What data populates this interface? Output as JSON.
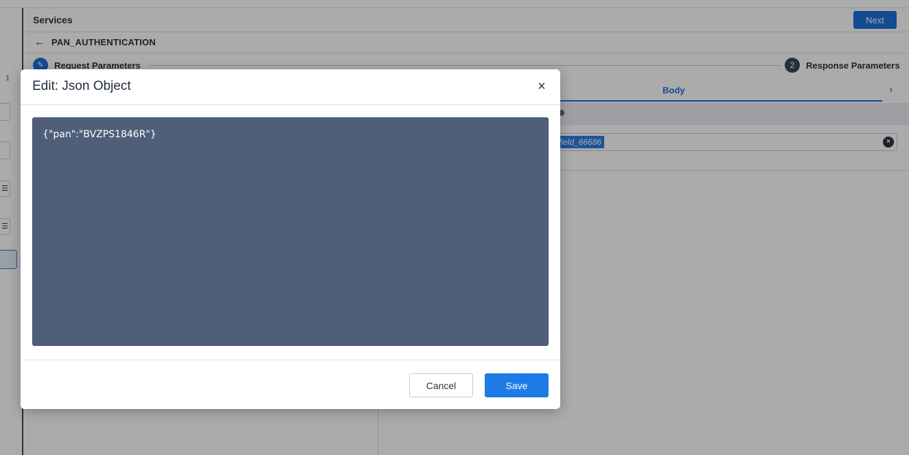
{
  "background": {
    "header": {
      "title": "Services",
      "next_label": "Next"
    },
    "subheader": {
      "title": "PAN_AUTHENTICATION"
    },
    "rail": {
      "number": "1"
    },
    "steps": {
      "step1": {
        "label": "Request Parameters",
        "icon": "pencil-icon"
      },
      "step2": {
        "number": "2",
        "label": "Response Parameters"
      }
    },
    "tabs": {
      "active_label": "Body"
    },
    "field": {
      "tag": "field_66686"
    }
  },
  "modal": {
    "title": "Edit: Json Object",
    "close_icon": "close-icon",
    "editor_value": "{\"pan\":\"BVZPS1846R\"}",
    "cancel_label": "Cancel",
    "save_label": "Save"
  },
  "colors": {
    "primary": "#1e6fd9",
    "editor_bg": "#4f5f7a",
    "overlay": "rgba(0,0,0,0.33)"
  }
}
